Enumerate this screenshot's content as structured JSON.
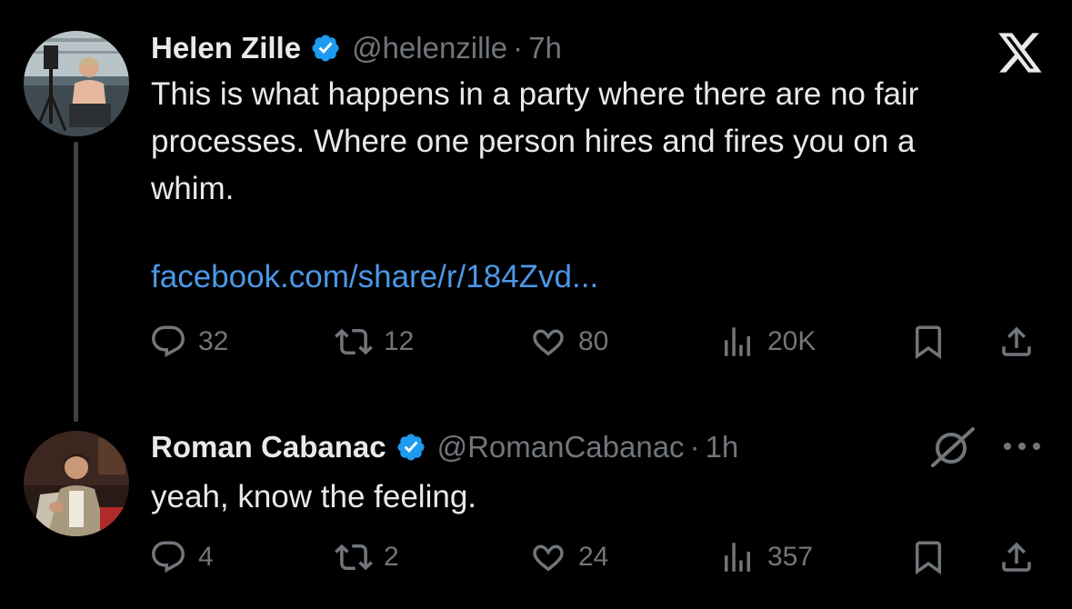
{
  "tweets": [
    {
      "author_name": "Helen Zille",
      "verified": true,
      "handle": "@helenzille",
      "separator": "·",
      "time": "7h",
      "text_paragraph_1": "This is what happens in a party where there are no fair\nprocesses. Where one person hires and fires you on a\nwhim.",
      "link_text": "facebook.com/share/r/184Zvd...",
      "stats": {
        "replies": "32",
        "reposts": "12",
        "likes": "80",
        "views": "20K"
      }
    },
    {
      "author_name": "Roman Cabanac",
      "verified": true,
      "handle": "@RomanCabanac",
      "separator": "·",
      "time": "1h",
      "text": "yeah, know the feeling.",
      "stats": {
        "replies": "4",
        "reposts": "2",
        "likes": "24",
        "views": "357"
      }
    }
  ],
  "icons": {
    "logo": "x-logo-icon",
    "verified": "verified-badge-icon",
    "reply": "reply-icon",
    "repost": "repost-icon",
    "like": "heart-icon",
    "views": "views-icon",
    "bookmark": "bookmark-icon",
    "share": "share-icon",
    "grok": "grok-icon",
    "more": "more-icon"
  },
  "colors": {
    "background": "#000000",
    "primary_text": "#e7e9ea",
    "secondary_text": "#71767b",
    "link": "#4b98e6",
    "verified_badge": "#1d9bf0",
    "thread_line": "#3e4144"
  }
}
